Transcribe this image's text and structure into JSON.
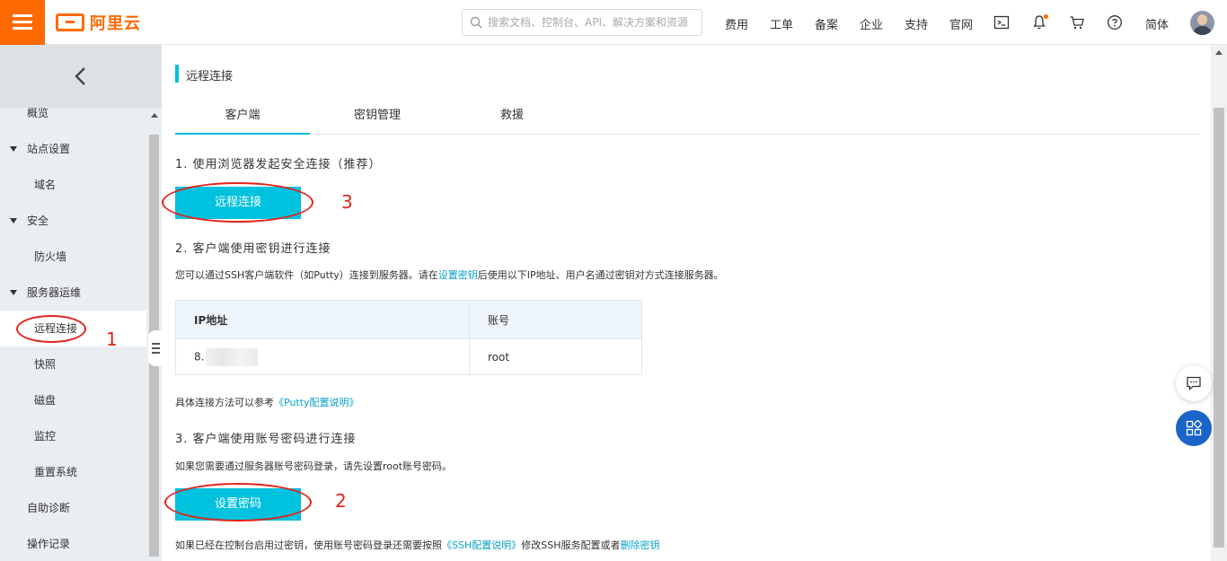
{
  "header": {
    "brand": "阿里云",
    "search_placeholder": "搜索文档、控制台、API、解决方案和资源",
    "nav": [
      "费用",
      "工单",
      "备案",
      "企业",
      "支持",
      "官网"
    ],
    "language": "简体",
    "icons": [
      "terminal-icon",
      "bell-icon",
      "cart-icon",
      "help-icon"
    ]
  },
  "sidebar": {
    "items": [
      {
        "label": "概览",
        "type": "group"
      },
      {
        "label": "站点设置",
        "type": "group"
      },
      {
        "label": "域名",
        "type": "child"
      },
      {
        "label": "安全",
        "type": "group"
      },
      {
        "label": "防火墙",
        "type": "child"
      },
      {
        "label": "服务器运维",
        "type": "group"
      },
      {
        "label": "远程连接",
        "type": "child",
        "active": true
      },
      {
        "label": "快照",
        "type": "child"
      },
      {
        "label": "磁盘",
        "type": "child"
      },
      {
        "label": "监控",
        "type": "child"
      },
      {
        "label": "重置系统",
        "type": "child"
      },
      {
        "label": "自助诊断",
        "type": "group"
      },
      {
        "label": "操作记录",
        "type": "group"
      }
    ]
  },
  "main": {
    "page_title": "远程连接",
    "tabs": [
      "客户端",
      "密钥管理",
      "救援"
    ],
    "active_tab": "客户端",
    "section1": {
      "title": "1. 使用浏览器发起安全连接（推荐）",
      "button": "远程连接"
    },
    "section2": {
      "title": "2. 客户端使用密钥进行连接",
      "desc_before": "您可以通过SSH客户端软件（如Putty）连接到服务器。请在",
      "desc_link": "设置密钥",
      "desc_after": "后使用以下IP地址、用户名通过密钥对方式连接服务器。",
      "table": {
        "headers": [
          "IP地址",
          "账号"
        ],
        "rows": [
          [
            "8.",
            "root"
          ]
        ]
      },
      "ref_before": "具体连接方法可以参考",
      "ref_link": "《Putty配置说明》"
    },
    "section3": {
      "title": "3. 客户端使用账号密码进行连接",
      "desc": "如果您需要通过服务器账号密码登录，请先设置root账号密码。",
      "button": "设置密码",
      "note_before": "如果已经在控制台启用过密钥，使用账号密码登录还需要按照",
      "note_link1": "《SSH配置说明》",
      "note_middle": "修改SSH服务配置或者",
      "note_link2": "删除密钥"
    }
  },
  "annotations": [
    "1",
    "2",
    "3"
  ],
  "colors": {
    "brand": "#ff6a00",
    "accent": "#00c1de",
    "annotation": "#e2231a",
    "link": "#0aa1c8"
  }
}
